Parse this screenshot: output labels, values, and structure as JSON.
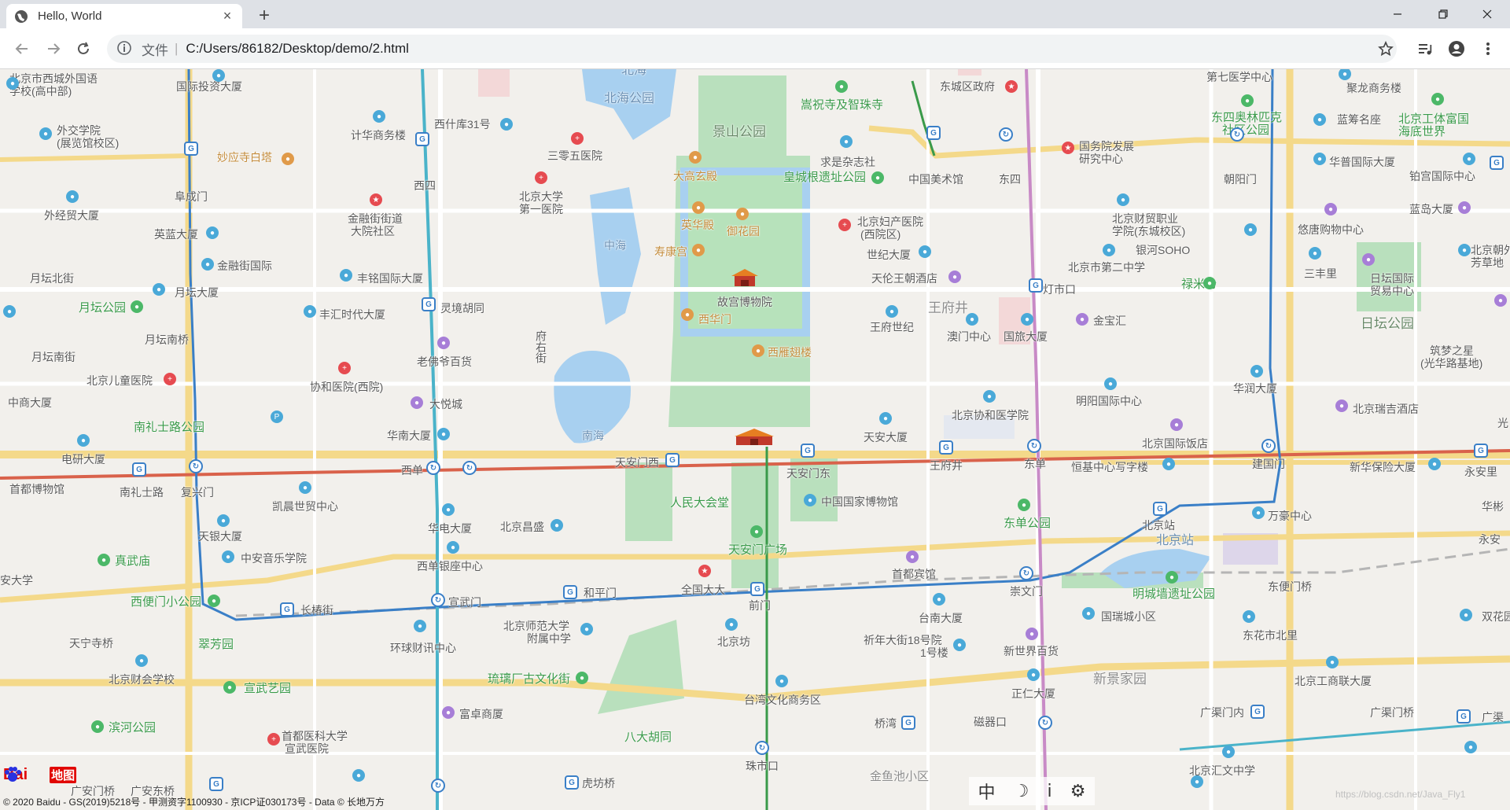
{
  "browser": {
    "tab_title": "Hello, World",
    "close_label": "×",
    "newtab_label": "+",
    "address_scheme": "文件",
    "address_sep": "|",
    "address_path": "C:/Users/86182/Desktop/demo/2.html"
  },
  "map": {
    "attribution": "© 2020 Baidu - GS(2019)5218号 - 甲测资字1100930 - 京ICP证030173号 - Data © 长地万方",
    "logo_text_1": "Bai",
    "logo_text_2": "地图",
    "controls": [
      "中",
      "☽",
      "ⅰ",
      "⚙"
    ],
    "watermark": "https://blog.csdn.net/Java_Fly1",
    "labels": {
      "l1": "北京市西城外国语",
      "l1b": "学校(高中部)",
      "l2": "国际投资大厦",
      "l3": "北海",
      "l4": "北海公园",
      "l5": "嵩祝寺及智珠寺",
      "l6": "东城区政府",
      "l7": "第七医学中心",
      "l8": "聚龙商务楼",
      "l9": "北京工体富国",
      "l9b": "海底世界",
      "l10": "外交学院",
      "l10b": "(展览馆校区)",
      "l11": "计华商务楼",
      "l12": "西什库31号",
      "l13": "景山公园",
      "l14": "三零五医院",
      "l15": "求是杂志社",
      "l16": "国务院发展",
      "l16b": "研究中心",
      "l17": "东四奥林匹克",
      "l17b": "社区公园",
      "l18": "蓝筹名座",
      "l19": "妙应寺白塔",
      "l20": "北京大学",
      "l20b": "第一医院",
      "l21": "大高玄殿",
      "l22": "皇城根遗址公园",
      "l23": "中国美术馆",
      "l24": "东四",
      "l25": "朝阳门",
      "l26": "华普国际大厦",
      "l27": "铂宫国际中心",
      "l28": "阜成门",
      "l29": "西四",
      "l30": "外经贸大厦",
      "l31": "金融街街道",
      "l31b": "大院社区",
      "l32": "英华殿",
      "l33": "御花园",
      "l34": "北京妇产医院",
      "l34b": "(西院区)",
      "l35": "北京财贸职业",
      "l35b": "学院(东城校区)",
      "l36": "悠唐购物中心",
      "l37": "蓝岛大厦",
      "l38": "英蓝大厦",
      "l39": "中海",
      "l40": "寿康宫",
      "l41": "世纪大厦",
      "l42": "银河SOHO",
      "l43": "北京朝外",
      "l43b": "芳草地",
      "l44": "金融街国际",
      "l45": "北京市第二中学",
      "l46": "三丰里",
      "l47": "日坛国际",
      "l47b": "贸易中心",
      "l48": "月坛北街",
      "l49": "丰铭国际大厦",
      "l50": "天伦王朝酒店",
      "l51": "禄米仓",
      "l52": "月坛大厦",
      "l53": "故宫博物院",
      "l54": "灯市口",
      "l55": "月坛公园",
      "l56": "灵境胡同",
      "l57": "王府井",
      "l58": "丰汇时代大厦",
      "l59": "西华门",
      "l60": "王府世纪",
      "l61": "澳门中心",
      "l62": "国旅大厦",
      "l63": "金宝汇",
      "l64": "日坛公园",
      "l65": "月坛南桥",
      "l66": "老佛爷百货",
      "l67": "府右街",
      "l68": "西雁翅楼",
      "l69": "筑梦之星",
      "l69b": "(光华路基地)",
      "l70": "月坛南街",
      "l71": "北京儿童医院",
      "l72": "协和医院(西院)",
      "l73": "明阳国际中心",
      "l74": "华润大厦",
      "l75": "中商大厦",
      "l76": "大悦城",
      "l77": "北京协和医学院",
      "l78": "北京瑞吉酒店",
      "l79": "南礼士路公园",
      "l80": "南海",
      "l81": "华南大厦",
      "l82": "天安大厦",
      "l83": "北京国际饭店",
      "l84": "电研大厦",
      "l85": "西单",
      "l86": "天安门西",
      "l87": "天安门东",
      "l88": "王府井",
      "l89": "东单",
      "l90": "恒基中心写字楼",
      "l91": "建国门",
      "l92": "新华保险大厦",
      "l93": "永安里",
      "l94": "首都博物馆",
      "l95": "南礼士路",
      "l96": "复兴门",
      "l97": "凯晨世贸中心",
      "l98": "人民大会堂",
      "l99": "中国国家博物馆",
      "l100": "华电大厦",
      "l101": "北京昌盛",
      "l102": "东单公园",
      "l103": "北京站",
      "l104": "万豪中心",
      "l105": "天银大厦",
      "l106": "中安音乐学院",
      "l107": "真武庙",
      "l108": "西单银座中心",
      "l109": "天安门广场",
      "l110": "首都宾馆",
      "l111": "北京站",
      "l112": "明城墙遗址公园",
      "l113": "东便门桥",
      "l114": "安大学",
      "l115": "西便门小公园",
      "l116": "长椿街",
      "l117": "宣武门",
      "l118": "和平门",
      "l119": "全国大大",
      "l120": "前门",
      "l121": "崇文门",
      "l122": "台南大厦",
      "l123": "国瑞城小区",
      "l124": "东花市北里",
      "l125": "双花园",
      "l126": "天宁寺桥",
      "l127": "翠芳园",
      "l128": "环球财讯中心",
      "l129": "北京师范大学",
      "l129b": "附属中学",
      "l130": "北京坊",
      "l131": "祈年大街18号院",
      "l131b": "1号楼",
      "l132": "新世界百货",
      "l133": "北京财会学校",
      "l134": "琉璃厂古文化街",
      "l135": "正仁大厦",
      "l136": "新景家园",
      "l137": "北京工商联大厦",
      "l138": "宣武艺园",
      "l139": "台湾文化商务区",
      "l140": "滨河公园",
      "l141": "富卓商厦",
      "l142": "桥湾",
      "l143": "磁器口",
      "l144": "广渠门内",
      "l145": "广渠门桥",
      "l146": "广渠",
      "l147": "首都医科大学",
      "l147b": "宣武医院",
      "l148": "八大胡同",
      "l149": "珠市口",
      "l150": "北京汇文中学",
      "l151": "金鱼池小区",
      "l152": "广安门桥",
      "l153": "广安东桥",
      "l154": "虎坊桥",
      "l155": "华彬",
      "l156": "永安",
      "l157": "王府井",
      "l158": "光"
    }
  }
}
